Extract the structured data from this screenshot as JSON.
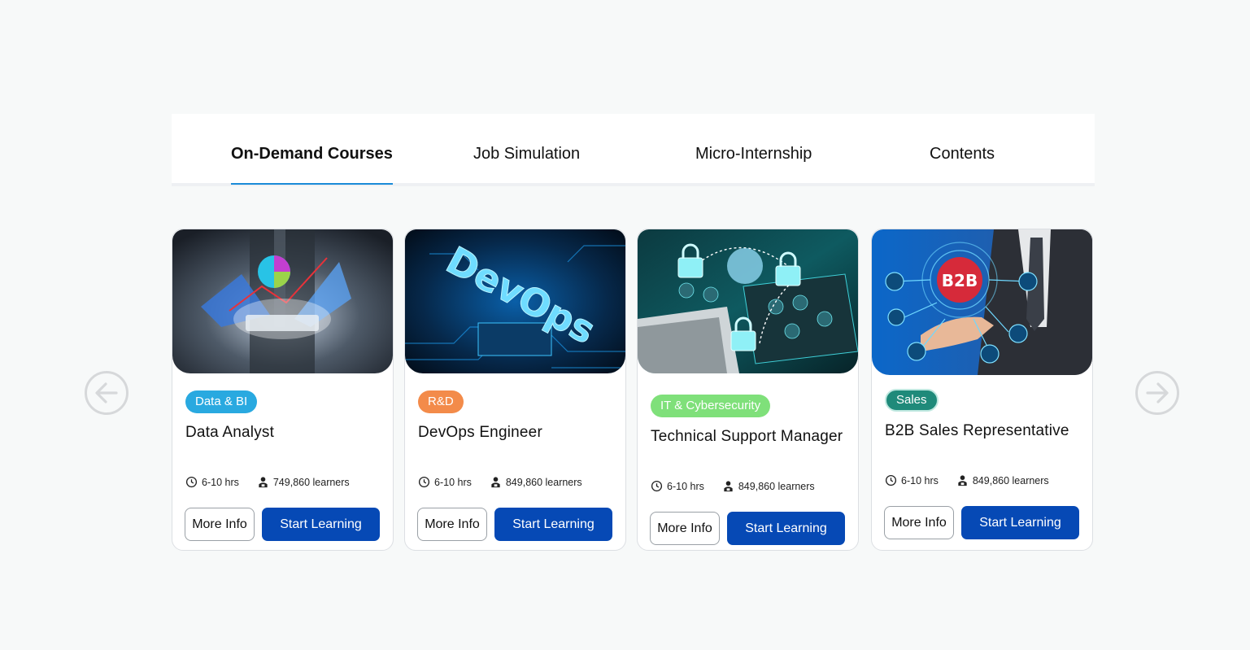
{
  "tabs": [
    {
      "label": "On-Demand Courses",
      "active": true
    },
    {
      "label": "Job Simulation",
      "active": false
    },
    {
      "label": "Micro-Internship",
      "active": false
    },
    {
      "label": "Contents",
      "active": false
    }
  ],
  "nav": {
    "prev_icon": "arrow-left-circle-icon",
    "next_icon": "arrow-right-circle-icon"
  },
  "colors": {
    "accent_underline": "#1a8bd8",
    "primary_button": "#0649b5",
    "tag_data_bi": "#29a9e0",
    "tag_rd": "#f38b4a",
    "tag_it": "#7fe07a",
    "tag_sales": "#1f8a7a"
  },
  "cards": [
    {
      "image_alt": "businessman holding tablet with analytics charts",
      "category": "Data & BI",
      "title": "Data Analyst",
      "duration": "6-10 hrs",
      "learners": "749,860 learners",
      "more_label": "More Info",
      "start_label": "Start Learning"
    },
    {
      "image_alt": "DevOps neon text on circuit board",
      "category": "R&D",
      "title": "DevOps Engineer",
      "duration": "6-10 hrs",
      "learners": "849,860 learners",
      "more_label": "More Info",
      "start_label": "Start Learning"
    },
    {
      "image_alt": "padlocks connected over laptop and tablet devices",
      "category": "IT & Cybersecurity",
      "title": "Technical Support Manager",
      "duration": "6-10 hrs",
      "learners": "849,860 learners",
      "more_label": "More Info",
      "start_label": "Start Learning"
    },
    {
      "image_alt": "businessman touching B2B hologram",
      "image_text": "B2B",
      "category": "Sales",
      "title": "B2B Sales Representative",
      "duration": "6-10 hrs",
      "learners": "849,860 learners",
      "more_label": "More Info",
      "start_label": "Start Learning"
    }
  ]
}
